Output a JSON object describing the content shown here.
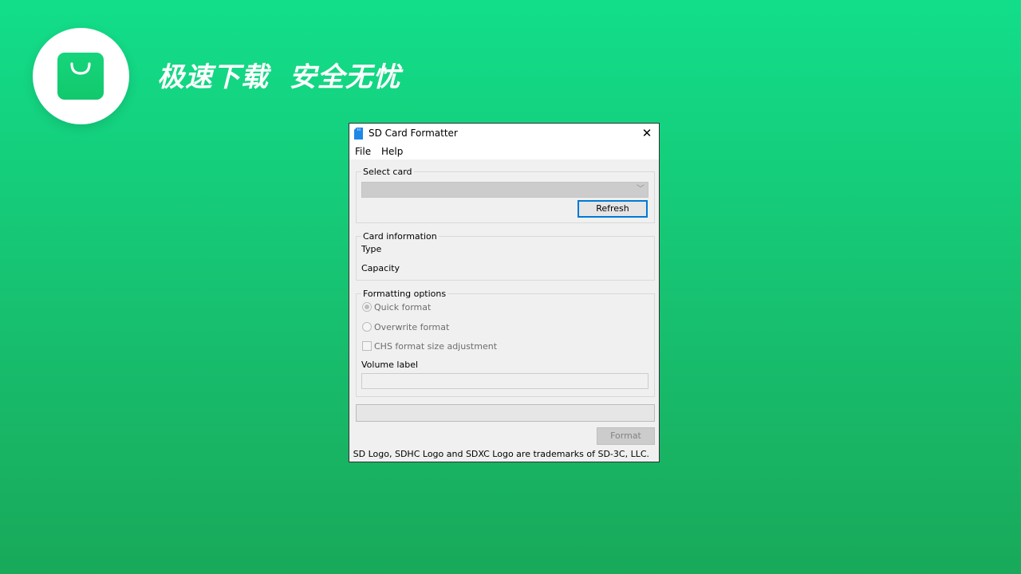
{
  "promo": {
    "slogan": "极速下载  安全无忧",
    "logo_icon": "shopping-bag-icon",
    "brand_color": "#13d47c"
  },
  "window": {
    "title": "SD Card Formatter",
    "app_icon": "sd-card-icon",
    "close_icon": "close-icon",
    "close_glyph": "✕",
    "menu": [
      "File",
      "Help"
    ],
    "select_card": {
      "group_title": "Select card",
      "selected_value": "",
      "dropdown_glyph": "﹀",
      "refresh_label": "Refresh"
    },
    "card_information": {
      "group_title": "Card information",
      "type_label": "Type",
      "capacity_label": "Capacity"
    },
    "formatting_options": {
      "group_title": "Formatting options",
      "quick_format_label": "Quick format",
      "quick_format_checked": true,
      "overwrite_format_label": "Overwrite format",
      "overwrite_format_checked": false,
      "chs_label": "CHS format size adjustment",
      "chs_checked": false,
      "volume_label_title": "Volume label",
      "volume_label_value": ""
    },
    "progress": 0,
    "format_label": "Format",
    "footer_note": "SD Logo, SDHC Logo and SDXC Logo are trademarks of SD-3C, LLC.",
    "accent_color": "#0078d7"
  }
}
